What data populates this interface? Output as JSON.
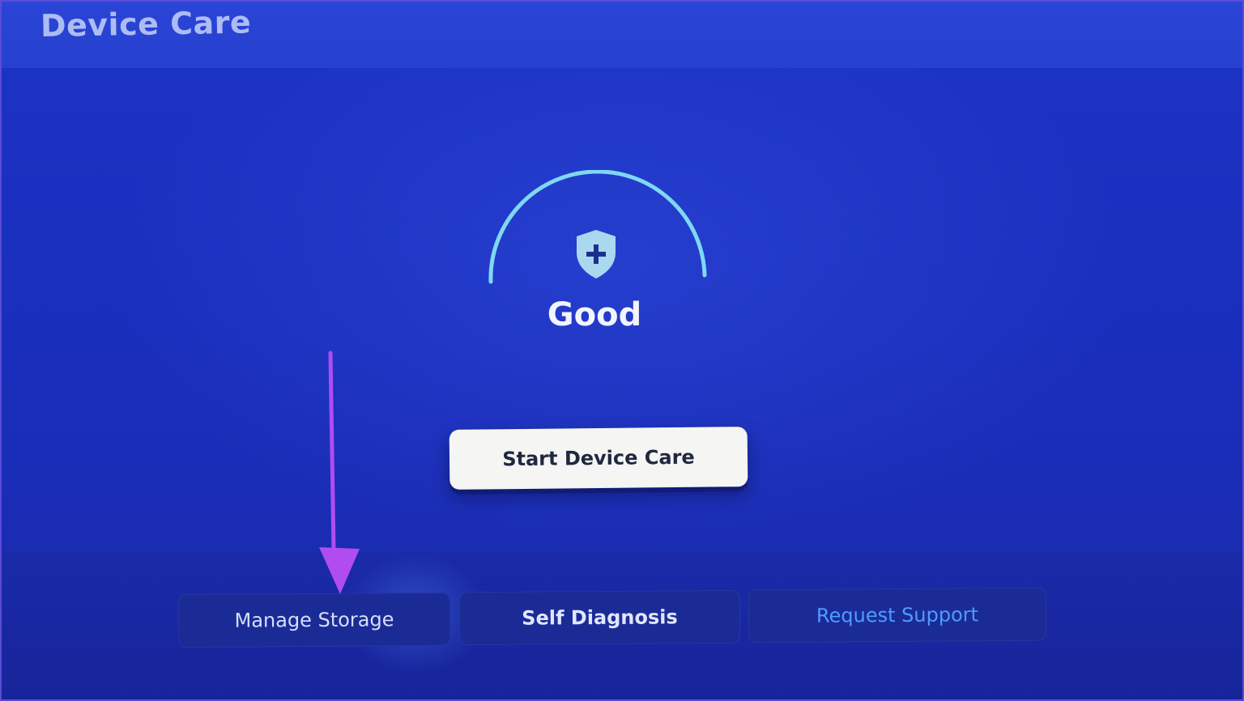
{
  "header": {
    "title": "Device Care"
  },
  "status": {
    "label": "Good",
    "icon": "shield-plus-icon"
  },
  "actions": {
    "start_label": "Start Device Care"
  },
  "options": [
    {
      "label": "Manage Storage"
    },
    {
      "label": "Self Diagnosis"
    },
    {
      "label": "Request Support"
    }
  ],
  "colors": {
    "background": "#1b30c0",
    "accent_arc": "#7fd8f2",
    "request_support_text": "#4f9bff",
    "annotation_arrow": "#b04cf0"
  }
}
